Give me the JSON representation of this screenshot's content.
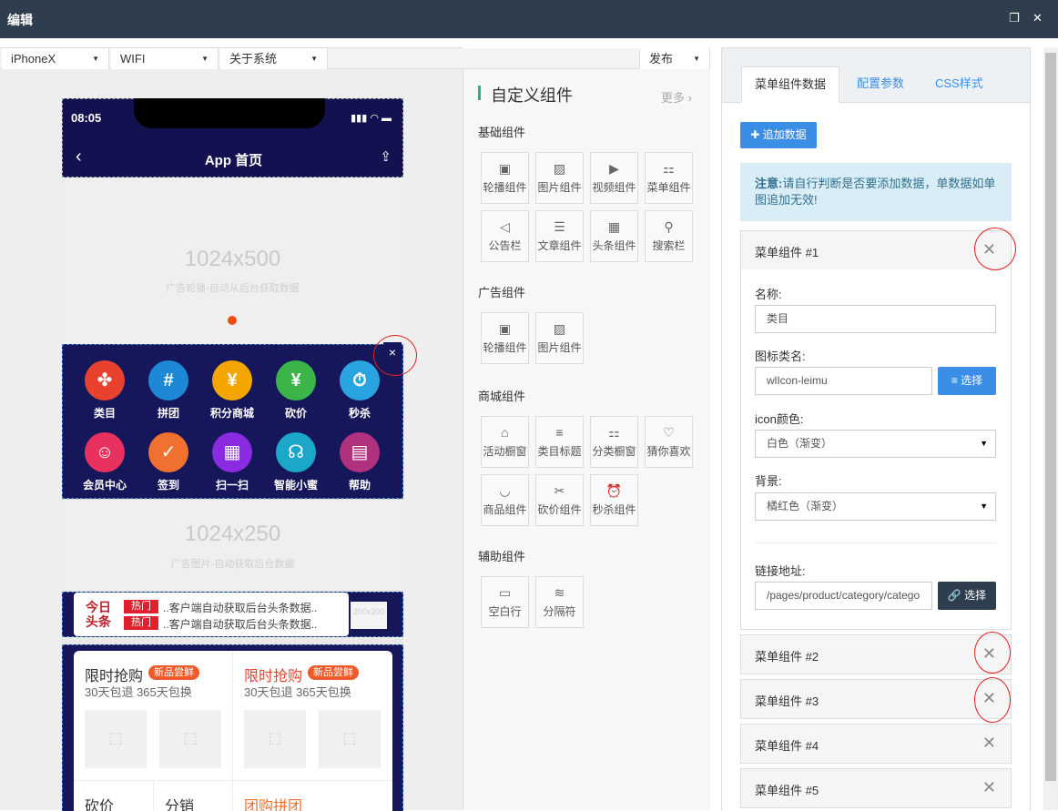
{
  "window": {
    "title": "编辑",
    "restore_icon": "restore-icon",
    "close_icon": "close-icon"
  },
  "toolbar": {
    "device": "iPhoneX",
    "network": "WIFI",
    "system": "关于系统",
    "publish": "发布"
  },
  "phone": {
    "time": "08:05",
    "status": "▮▮▮ ◠ ▬",
    "title": "App 首页",
    "back": "‹",
    "share": "⇪",
    "banner_size": "1024x500",
    "banner_desc": "广告轮播-自动从后台获取数据",
    "menu_items": [
      {
        "label": "类目",
        "color": "#e8412e",
        "icon": "✤"
      },
      {
        "label": "拼团",
        "color": "#1e88d6",
        "icon": "#"
      },
      {
        "label": "积分商城",
        "color": "#f5a500",
        "icon": "¥"
      },
      {
        "label": "砍价",
        "color": "#3bb54a",
        "icon": "¥"
      },
      {
        "label": "秒杀",
        "color": "#2aa4e0",
        "icon": "⏱"
      },
      {
        "label": "会员中心",
        "color": "#e8315f",
        "icon": "☺"
      },
      {
        "label": "签到",
        "color": "#f07030",
        "icon": "✓"
      },
      {
        "label": "扫一扫",
        "color": "#8a2be2",
        "icon": "▦"
      },
      {
        "label": "智能小蜜",
        "color": "#1ba8c8",
        "icon": "☊"
      },
      {
        "label": "帮助",
        "color": "#b0327f",
        "icon": "▤"
      }
    ],
    "close_menu": "×",
    "image2_size": "1024x250",
    "image2_desc": "广告图片-自动获取后台数据",
    "news": {
      "logo": "今日\n头条",
      "hot_label": "热门",
      "items": [
        "..客户端自动获取后台头条数据..",
        "..客户端自动获取后台头条数据.."
      ],
      "thumb": "200x200"
    },
    "promo": {
      "left_title": "限时抢购",
      "left_badge": "新品尝鲜",
      "left_sub": "30天包退 365天包换",
      "right_title": "限时抢购",
      "right_badge": "新品尝鲜",
      "right_sub": "30天包退 365天包换",
      "bottom": [
        "砍价",
        "分销",
        "团购拼团"
      ]
    }
  },
  "components": {
    "title": "自定义组件",
    "more": "更多",
    "sections": [
      {
        "name": "基础组件",
        "items": [
          {
            "label": "轮播组件",
            "icon": "▣"
          },
          {
            "label": "图片组件",
            "icon": "▨"
          },
          {
            "label": "视频组件",
            "icon": "▶"
          },
          {
            "label": "菜单组件",
            "icon": "⚏"
          },
          {
            "label": "公告栏",
            "icon": "◁"
          },
          {
            "label": "文章组件",
            "icon": "☰"
          },
          {
            "label": "头条组件",
            "icon": "▦"
          },
          {
            "label": "搜索栏",
            "icon": "⚲"
          }
        ]
      },
      {
        "name": "广告组件",
        "items": [
          {
            "label": "轮播组件",
            "icon": "▣"
          },
          {
            "label": "图片组件",
            "icon": "▨"
          }
        ]
      },
      {
        "name": "商城组件",
        "items": [
          {
            "label": "活动橱窗",
            "icon": "⌂"
          },
          {
            "label": "类目标题",
            "icon": "≡"
          },
          {
            "label": "分类橱窗",
            "icon": "⚏"
          },
          {
            "label": "猜你喜欢",
            "icon": "♡"
          },
          {
            "label": "商品组件",
            "icon": "◡"
          },
          {
            "label": "砍价组件",
            "icon": "✂"
          },
          {
            "label": "秒杀组件",
            "icon": "⏰"
          }
        ]
      },
      {
        "name": "辅助组件",
        "items": [
          {
            "label": "空白行",
            "icon": "▭"
          },
          {
            "label": "分隔符",
            "icon": "≋"
          }
        ]
      }
    ]
  },
  "panel": {
    "tabs": [
      "菜单组件数据",
      "配置参数",
      "CSS样式"
    ],
    "add_button": "✚ 追加数据",
    "notice_label": "注意:",
    "notice_text": "请自行判断是否要添加数据，单数据如单图追加无效!",
    "items": [
      "菜单组件 #1",
      "菜单组件 #2",
      "菜单组件 #3",
      "菜单组件 #4",
      "菜单组件 #5"
    ],
    "form": {
      "name_label": "名称:",
      "name_value": "类目",
      "icon_label": "图标类名:",
      "icon_value": "wlIcon-leimu",
      "select_btn": "≡ 选择",
      "color_label": "icon颜色:",
      "color_value": "白色（渐变）",
      "bg_label": "背景:",
      "bg_value": "橘红色（渐变）",
      "link_label": "链接地址:",
      "link_value": "/pages/product/category/catego",
      "link_btn": "🔗 选择"
    }
  },
  "colors": {
    "title_bar": "#2f3e4e",
    "primary": "#3a8ee6",
    "dark_btn": "#2f3e4e",
    "accent": "#f04d12"
  }
}
